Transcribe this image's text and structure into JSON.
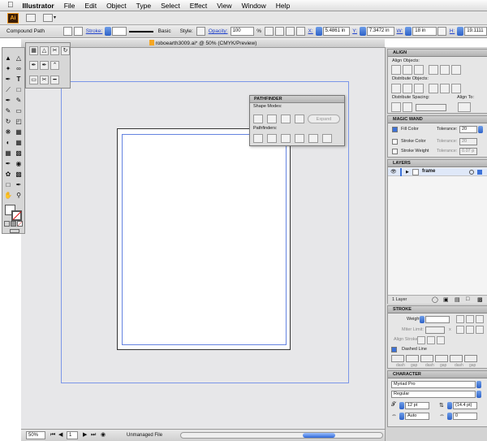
{
  "menubar": {
    "app_name": "Illustrator",
    "items": [
      "File",
      "Edit",
      "Object",
      "Type",
      "Select",
      "Effect",
      "View",
      "Window",
      "Help"
    ]
  },
  "appbar": {
    "logo": "Ai"
  },
  "control_bar": {
    "selection_type": "Compound Path",
    "stroke_label": "Stroke:",
    "brush_name": "Basic",
    "style_label": "Style:",
    "opacity_label": "Opacity:",
    "opacity_value": "100",
    "opacity_unit": "%",
    "x_label": "X:",
    "x_value": "5.4861 in",
    "y_label": "Y:",
    "y_value": "7.3472 in",
    "w_label": "W:",
    "w_value": "18 in",
    "h_label": "H:",
    "h_value": "19.1111"
  },
  "document": {
    "tab_title": "roboearth3009.ai* @ 50% (CMYK/Preview)"
  },
  "pathfinder": {
    "title": "PATHFINDER",
    "shape_modes_label": "Shape Modes:",
    "pathfinders_label": "Pathfinders:",
    "expand_label": "Expand"
  },
  "align": {
    "title": "ALIGN",
    "align_objects_label": "Align Objects:",
    "distribute_objects_label": "Distribute Objects:",
    "distribute_spacing_label": "Distribute Spacing:",
    "align_to_label": "Align To:"
  },
  "magic_wand": {
    "title": "MAGIC WAND",
    "fill_color_label": "Fill Color",
    "fill_color_checked": true,
    "fill_tolerance": "20",
    "stroke_color_label": "Stroke Color",
    "stroke_tolerance": "20",
    "stroke_weight_label": "Stroke Weight",
    "weight_tolerance": "0.07 p",
    "tolerance_label": "Tolerance:"
  },
  "layers": {
    "title": "LAYERS",
    "layer_name": "frame",
    "footer": "1 Layer"
  },
  "stroke": {
    "title": "STROKE",
    "weight_label": "Weight:",
    "miter_label": "Miter Limit:",
    "miter_suffix": "x",
    "align_label": "Align Stroke:",
    "dashed_label": "Dashed Line",
    "dash_labels": [
      "dash",
      "gap",
      "dash",
      "gap",
      "dash",
      "gap"
    ]
  },
  "character": {
    "title": "CHARACTER",
    "font_family": "Myriad Pro",
    "font_style": "Regular",
    "size": "12 pt",
    "leading": "(14.4 pt)",
    "kerning": "Auto",
    "tracking": "0"
  },
  "statusbar": {
    "zoom": "50%",
    "page": "1",
    "status": "Unmanaged File"
  }
}
